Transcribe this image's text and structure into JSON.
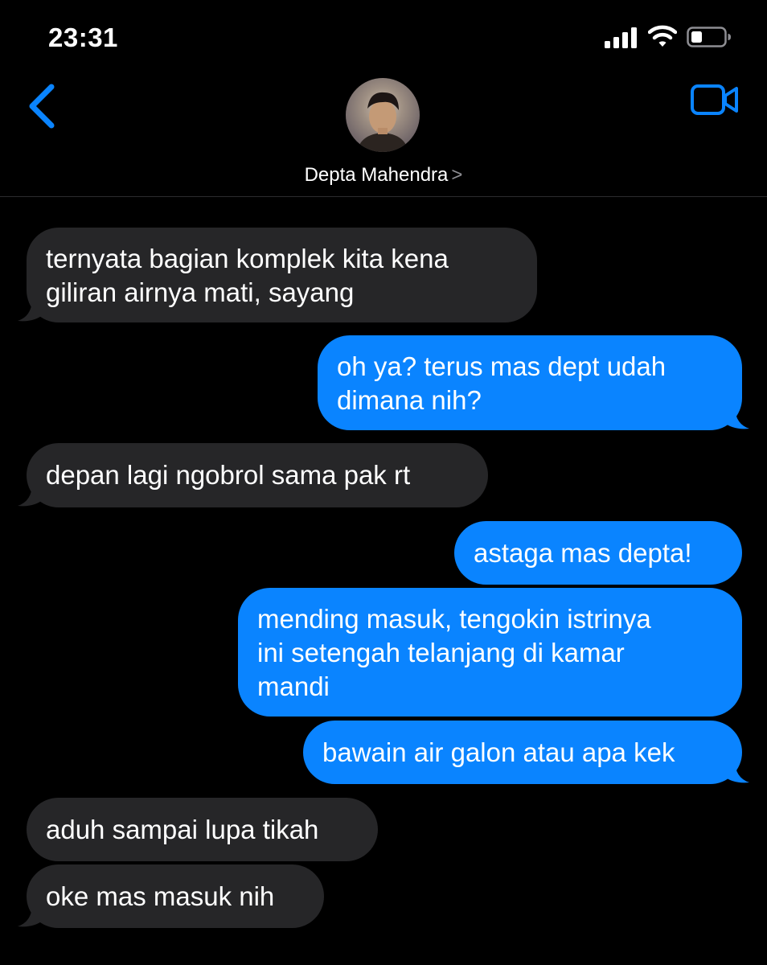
{
  "status_bar": {
    "time": "23:31"
  },
  "header": {
    "contact_name": "Depta Mahendra",
    "chevron": ">"
  },
  "messages": [
    {
      "direction": "incoming",
      "text": "ternyata bagian komplek kita kena\ngiliran airnya mati, sayang"
    },
    {
      "direction": "outgoing",
      "text": "oh ya? terus mas dept udah\ndimana nih?"
    },
    {
      "direction": "incoming",
      "text": "depan lagi ngobrol sama pak rt"
    },
    {
      "direction": "outgoing",
      "text": "astaga mas depta!"
    },
    {
      "direction": "outgoing",
      "text": "mending masuk, tengokin istrinya\nini setengah telanjang di kamar\nmandi"
    },
    {
      "direction": "outgoing",
      "text": "bawain air galon atau apa kek"
    },
    {
      "direction": "incoming",
      "text": "aduh sampai lupa tikah"
    },
    {
      "direction": "incoming",
      "text": "oke mas masuk nih"
    }
  ],
  "colors": {
    "background": "#000000",
    "incoming_bubble": "#262628",
    "outgoing_bubble": "#0a84ff",
    "accent": "#0a84ff"
  },
  "icons": [
    "cellular-signal-icon",
    "wifi-icon",
    "battery-icon",
    "back-chevron-icon",
    "video-call-icon"
  ]
}
